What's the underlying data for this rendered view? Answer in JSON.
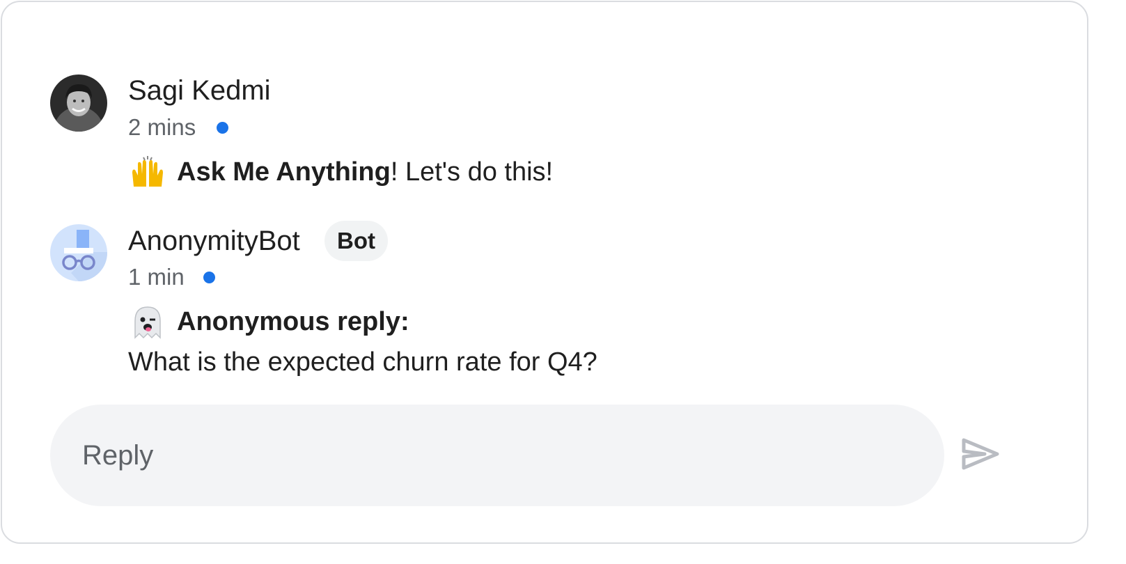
{
  "messages": [
    {
      "author": "Sagi Kedmi",
      "time": "2 mins",
      "emoji_icon": "raising-hands-emoji",
      "bold_text": "Ask Me Anything",
      "text": "! Let's do this!"
    },
    {
      "author": "AnonymityBot",
      "badge": "Bot",
      "time": "1 min",
      "emoji_icon": "winking-ghost-emoji",
      "bold_text": "Anonymous reply:",
      "text": "What is the expected churn rate for Q4?"
    }
  ],
  "reply": {
    "placeholder": "Reply",
    "value": "",
    "send_icon": "send-icon"
  },
  "colors": {
    "unread_dot": "#1a73e8",
    "border": "#dadce0",
    "reply_bg": "#f3f4f6",
    "send_icon": "#b9bcc2"
  }
}
